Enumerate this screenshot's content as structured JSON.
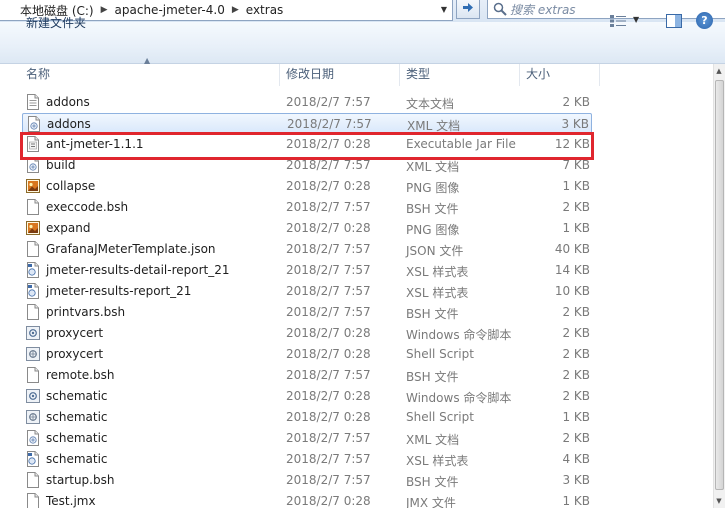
{
  "address": {
    "crumbs": [
      "本地磁盘 (C:)",
      "apache-jmeter-4.0",
      "extras"
    ],
    "search_placeholder": "搜索 extras"
  },
  "toolbar": {
    "new_folder_label": "新建文件夹",
    "help_label": "?"
  },
  "columns": {
    "name": "名称",
    "date": "修改日期",
    "type": "类型",
    "size": "大小"
  },
  "files": [
    {
      "name": "addons",
      "date": "2018/2/7 7:57",
      "type": "文本文档",
      "size": "2 KB",
      "icon": "text-file-icon"
    },
    {
      "name": "addons",
      "date": "2018/2/7 7:57",
      "type": "XML 文档",
      "size": "3 KB",
      "icon": "xml-file-icon",
      "selected": true
    },
    {
      "name": "ant-jmeter-1.1.1",
      "date": "2018/2/7 0:28",
      "type": "Executable Jar File",
      "size": "12 KB",
      "icon": "jar-file-icon",
      "highlighted": true
    },
    {
      "name": "build",
      "date": "2018/2/7 7:57",
      "type": "XML 文档",
      "size": "7 KB",
      "icon": "xml-file-icon"
    },
    {
      "name": "collapse",
      "date": "2018/2/7 0:28",
      "type": "PNG 图像",
      "size": "1 KB",
      "icon": "png-file-icon"
    },
    {
      "name": "execcode.bsh",
      "date": "2018/2/7 7:57",
      "type": "BSH 文件",
      "size": "2 KB",
      "icon": "blank-file-icon"
    },
    {
      "name": "expand",
      "date": "2018/2/7 0:28",
      "type": "PNG 图像",
      "size": "1 KB",
      "icon": "png-file-icon"
    },
    {
      "name": "GrafanaJMeterTemplate.json",
      "date": "2018/2/7 7:57",
      "type": "JSON 文件",
      "size": "40 KB",
      "icon": "blank-file-icon"
    },
    {
      "name": "jmeter-results-detail-report_21",
      "date": "2018/2/7 7:57",
      "type": "XSL 样式表",
      "size": "14 KB",
      "icon": "xsl-file-icon"
    },
    {
      "name": "jmeter-results-report_21",
      "date": "2018/2/7 7:57",
      "type": "XSL 样式表",
      "size": "10 KB",
      "icon": "xsl-file-icon"
    },
    {
      "name": "printvars.bsh",
      "date": "2018/2/7 7:57",
      "type": "BSH 文件",
      "size": "2 KB",
      "icon": "blank-file-icon"
    },
    {
      "name": "proxycert",
      "date": "2018/2/7 0:28",
      "type": "Windows 命令脚本",
      "size": "2 KB",
      "icon": "cmd-script-icon"
    },
    {
      "name": "proxycert",
      "date": "2018/2/7 0:28",
      "type": "Shell Script",
      "size": "2 KB",
      "icon": "shell-script-icon"
    },
    {
      "name": "remote.bsh",
      "date": "2018/2/7 7:57",
      "type": "BSH 文件",
      "size": "2 KB",
      "icon": "blank-file-icon"
    },
    {
      "name": "schematic",
      "date": "2018/2/7 0:28",
      "type": "Windows 命令脚本",
      "size": "2 KB",
      "icon": "cmd-script-icon"
    },
    {
      "name": "schematic",
      "date": "2018/2/7 0:28",
      "type": "Shell Script",
      "size": "1 KB",
      "icon": "shell-script-icon"
    },
    {
      "name": "schematic",
      "date": "2018/2/7 7:57",
      "type": "XML 文档",
      "size": "2 KB",
      "icon": "xml-file-icon"
    },
    {
      "name": "schematic",
      "date": "2018/2/7 7:57",
      "type": "XSL 样式表",
      "size": "4 KB",
      "icon": "xsl-file-icon"
    },
    {
      "name": "startup.bsh",
      "date": "2018/2/7 7:57",
      "type": "BSH 文件",
      "size": "3 KB",
      "icon": "blank-file-icon"
    },
    {
      "name": "Test.jmx",
      "date": "2018/2/7 0:28",
      "type": "JMX 文件",
      "size": "1 KB",
      "icon": "blank-file-icon"
    }
  ],
  "colors": {
    "highlight": "#e0262e",
    "selection_border": "#8fb2e0"
  }
}
